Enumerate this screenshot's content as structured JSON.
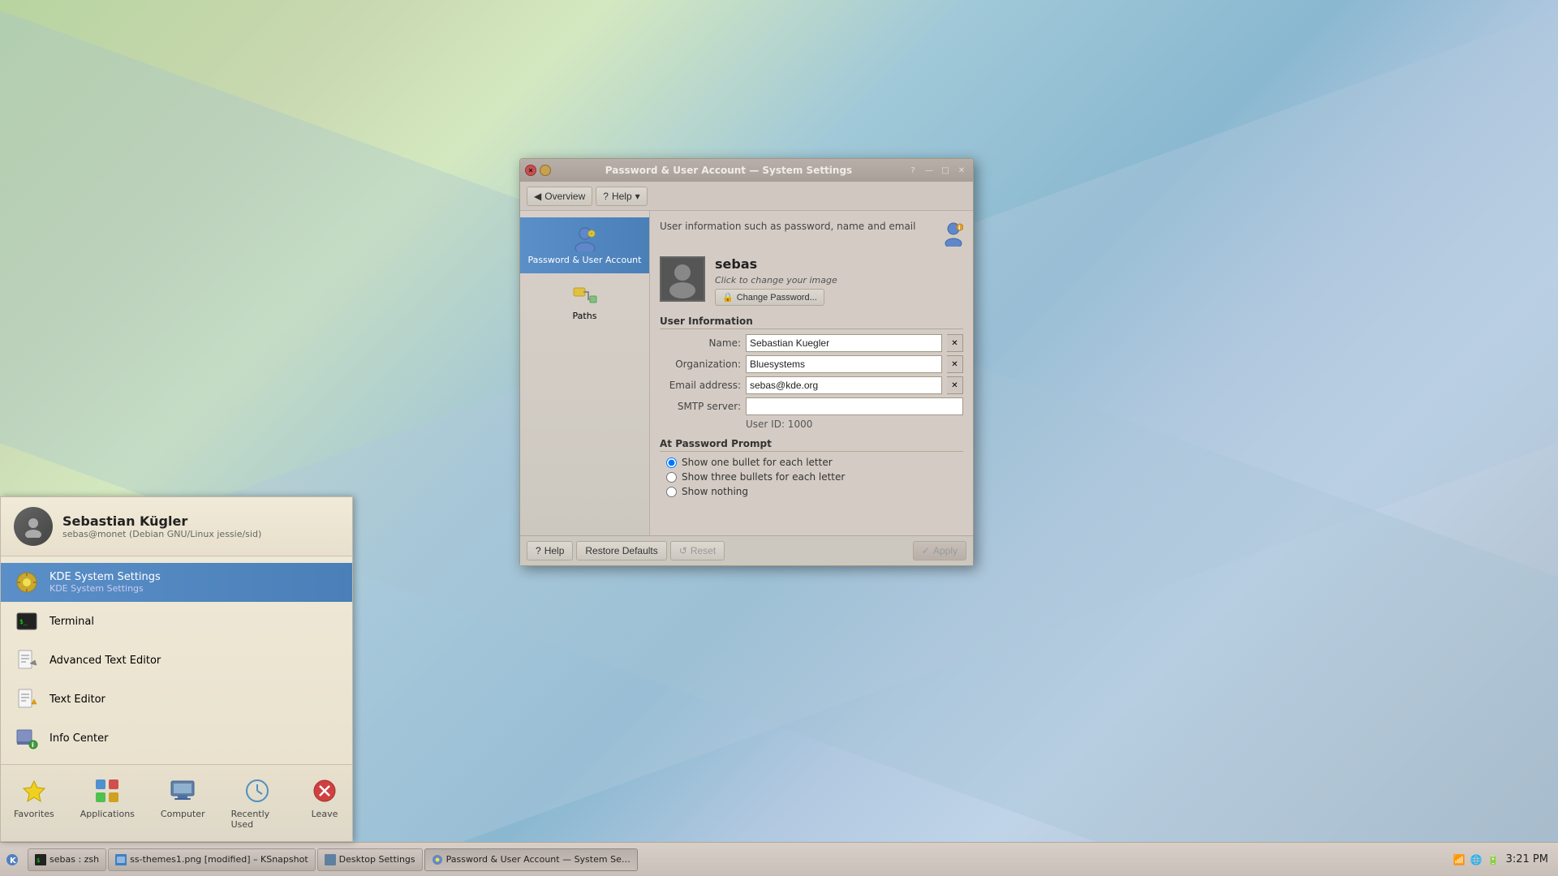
{
  "desktop": {
    "background": "kde-gradient"
  },
  "launcher": {
    "user": {
      "name": "Sebastian Kügler",
      "email": "sebas@monet (Debian GNU/Linux jessie/sid)"
    },
    "apps": [
      {
        "id": "kde-system-settings",
        "name": "KDE System Settings",
        "subtitle": "KDE System Settings",
        "selected": true
      },
      {
        "id": "terminal",
        "name": "Terminal",
        "subtitle": ""
      },
      {
        "id": "advanced-text-editor",
        "name": "Advanced Text Editor",
        "subtitle": ""
      },
      {
        "id": "text-editor",
        "name": "Text Editor",
        "subtitle": ""
      },
      {
        "id": "info-center",
        "name": "Info Center",
        "subtitle": ""
      }
    ],
    "bottom_items": [
      {
        "id": "favorites",
        "label": "Favorites"
      },
      {
        "id": "applications",
        "label": "Applications"
      },
      {
        "id": "computer",
        "label": "Computer"
      },
      {
        "id": "recently-used",
        "label": "Recently Used"
      },
      {
        "id": "leave",
        "label": "Leave"
      }
    ]
  },
  "settings_window": {
    "title": "Password & User Account — System Settings",
    "toolbar": {
      "overview_label": "Overview",
      "help_label": "Help"
    },
    "sidebar": {
      "items": [
        {
          "id": "password-user-account",
          "label": "Password & User Account",
          "active": true
        },
        {
          "id": "paths",
          "label": "Paths",
          "active": false
        }
      ]
    },
    "page": {
      "description": "User information such as password, name and email",
      "user": {
        "display_name": "sebas",
        "click_to_change": "Click to change your image",
        "change_password_label": "Change Password..."
      },
      "sections": {
        "user_info": {
          "title": "User Information",
          "fields": {
            "name_label": "Name:",
            "name_value": "Sebastian Kuegler",
            "org_label": "Organization:",
            "org_value": "Bluesystems",
            "email_label": "Email address:",
            "email_value": "sebas@kde.org",
            "smtp_label": "SMTP server:",
            "smtp_value": "",
            "user_id_label": "User ID: 1000",
            "user_id_value": "1000"
          }
        },
        "at_password_prompt": {
          "title": "At Password Prompt",
          "options": [
            {
              "id": "one-bullet",
              "label": "Show one bullet for each letter",
              "checked": true
            },
            {
              "id": "three-bullets",
              "label": "Show three bullets for each letter",
              "checked": false
            },
            {
              "id": "nothing",
              "label": "Show nothing",
              "checked": false
            }
          ]
        }
      }
    },
    "footer": {
      "help_label": "Help",
      "restore_label": "Restore Defaults",
      "reset_label": "Reset",
      "apply_label": "Apply"
    }
  },
  "taskbar": {
    "apps": [
      {
        "id": "sebas-zsh",
        "label": "sebas : zsh",
        "active": false
      },
      {
        "id": "ksnapshot",
        "label": "ss-themes1.png [modified] – KSnapshot",
        "active": false
      },
      {
        "id": "desktop-settings",
        "label": "Desktop Settings",
        "active": false
      },
      {
        "id": "system-settings",
        "label": "Password & User Account — System Se…",
        "active": true
      }
    ],
    "clock": "3:21 PM"
  }
}
